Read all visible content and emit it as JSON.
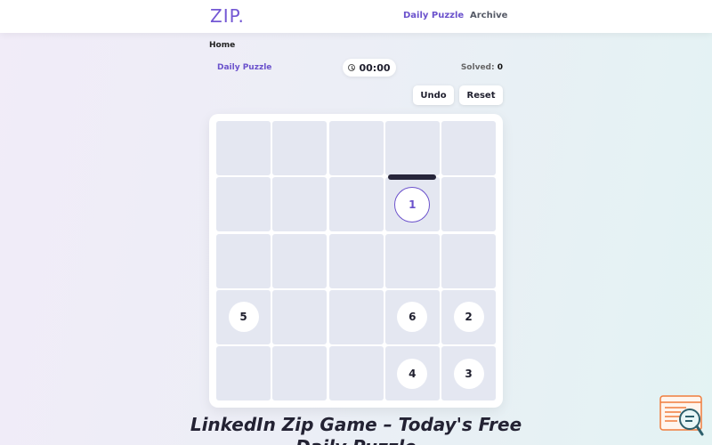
{
  "header": {
    "logo": "ZIP.",
    "nav": {
      "daily": "Daily Puzzle",
      "archive": "Archive"
    }
  },
  "breadcrumb": "Home",
  "puzzle": {
    "label": "Daily Puzzle",
    "timer": "00:00",
    "solved_label": "Solved:",
    "solved_count": "0"
  },
  "buttons": {
    "undo": "Undo",
    "reset": "Reset"
  },
  "board": {
    "rows": 5,
    "cols": 5,
    "cells": [
      [
        "",
        "",
        "",
        "",
        ""
      ],
      [
        "",
        "",
        "",
        "1",
        ""
      ],
      [
        "",
        "",
        "",
        "",
        ""
      ],
      [
        "5",
        "",
        "",
        "6",
        "2"
      ],
      [
        "",
        "",
        "",
        "4",
        "3"
      ]
    ]
  },
  "headline": "LinkedIn Zip Game – Today's Free Daily Puzzle",
  "colors": {
    "accent": "#6b52cc",
    "cell": "#e4e7f1",
    "wall": "#26253a",
    "widget": "#f07c3c"
  }
}
